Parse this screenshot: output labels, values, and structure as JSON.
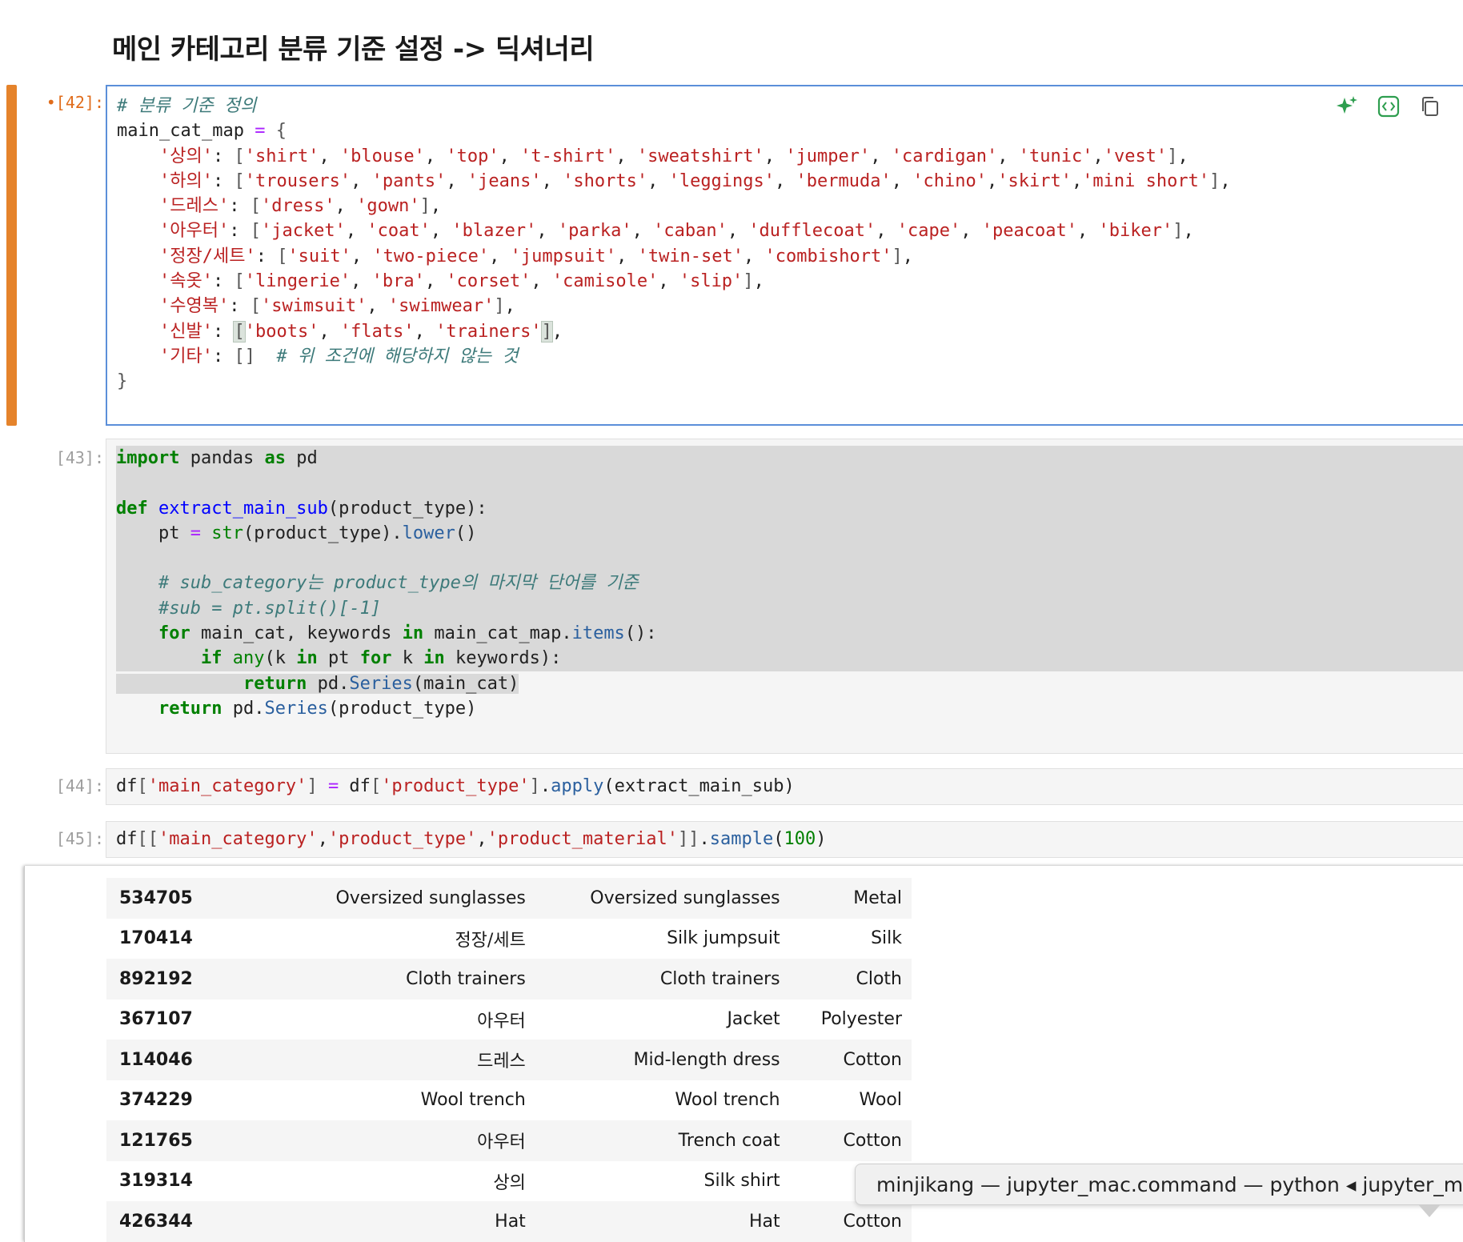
{
  "notebook": {
    "section_heading": "메인 카테고리 분류 기준 설정 -> 딕셔너리",
    "cells": [
      {
        "prompt": "[42]:",
        "dirty_marker": "•"
      },
      {
        "prompt": "[43]:"
      },
      {
        "prompt": "[44]:"
      },
      {
        "prompt": "[45]:"
      }
    ],
    "cell_toolbar_icons": [
      "sparkle-ai-icon",
      "code-brackets-icon",
      "duplicate-icon",
      "move-up-icon"
    ],
    "code": {
      "c42": [
        "# 분류 기준 정의",
        "main_cat_map = {",
        "    '상의': ['shirt', 'blouse', 'top', 't-shirt', 'sweatshirt', 'jumper', 'cardigan', 'tunic','vest'],",
        "    '하의': ['trousers', 'pants', 'jeans', 'shorts', 'leggings', 'bermuda', 'chino','skirt','mini short'],",
        "    '드레스': ['dress', 'gown'],",
        "    '아우터': ['jacket', 'coat', 'blazer', 'parka', 'caban', 'dufflecoat', 'cape', 'peacoat', 'biker'],",
        "    '정장/세트': ['suit', 'two-piece', 'jumpsuit', 'twin-set', 'combishort'],",
        "    '속옷': ['lingerie', 'bra', 'corset', 'camisole', 'slip'],",
        "    '수영복': ['swimsuit', 'swimwear'],",
        "    '신발': ['boots', 'flats', 'trainers'],",
        "    '기타': []  # 위 조건에 해당하지 않는 것",
        "}"
      ],
      "c43": [
        "import pandas as pd",
        "",
        "def extract_main_sub(product_type):",
        "    pt = str(product_type).lower()",
        "",
        "    # sub_category는 product_type의 마지막 단어를 기준",
        "    #sub = pt.split()[-1]",
        "    for main_cat, keywords in main_cat_map.items():",
        "        if any(k in pt for k in keywords):",
        "            return pd.Series(main_cat)",
        "    return pd.Series(product_type)"
      ],
      "c44": "df['main_category'] = df['product_type'].apply(extract_main_sub)",
      "c45": "df[['main_category','product_type','product_material']].sample(100)"
    },
    "output_table": {
      "rows": [
        {
          "index": "534705",
          "main_category": "Oversized sunglasses",
          "product_type": "Oversized sunglasses",
          "product_material": "Metal"
        },
        {
          "index": "170414",
          "main_category": "정장/세트",
          "product_type": "Silk jumpsuit",
          "product_material": "Silk"
        },
        {
          "index": "892192",
          "main_category": "Cloth trainers",
          "product_type": "Cloth trainers",
          "product_material": "Cloth"
        },
        {
          "index": "367107",
          "main_category": "아우터",
          "product_type": "Jacket",
          "product_material": "Polyester"
        },
        {
          "index": "114046",
          "main_category": "드레스",
          "product_type": "Mid-length dress",
          "product_material": "Cotton"
        },
        {
          "index": "374229",
          "main_category": "Wool trench",
          "product_type": "Wool trench",
          "product_material": "Wool"
        },
        {
          "index": "121765",
          "main_category": "아우터",
          "product_type": "Trench coat",
          "product_material": "Cotton"
        },
        {
          "index": "319314",
          "main_category": "상의",
          "product_type": "Silk shirt",
          "product_material": ""
        },
        {
          "index": "426344",
          "main_category": "Hat",
          "product_type": "Hat",
          "product_material": "Cotton"
        }
      ]
    }
  },
  "terminal_tooltip": "minjikang — jupyter_mac.command — python ◂ jupyter_m",
  "colors": {
    "active_cell_bar": "#e5832b",
    "focused_editor_border": "#5b8fd9",
    "string": "#ba2121",
    "keyword": "#008000",
    "comment": "#3d7a7a",
    "operator": "#aa22ff"
  }
}
